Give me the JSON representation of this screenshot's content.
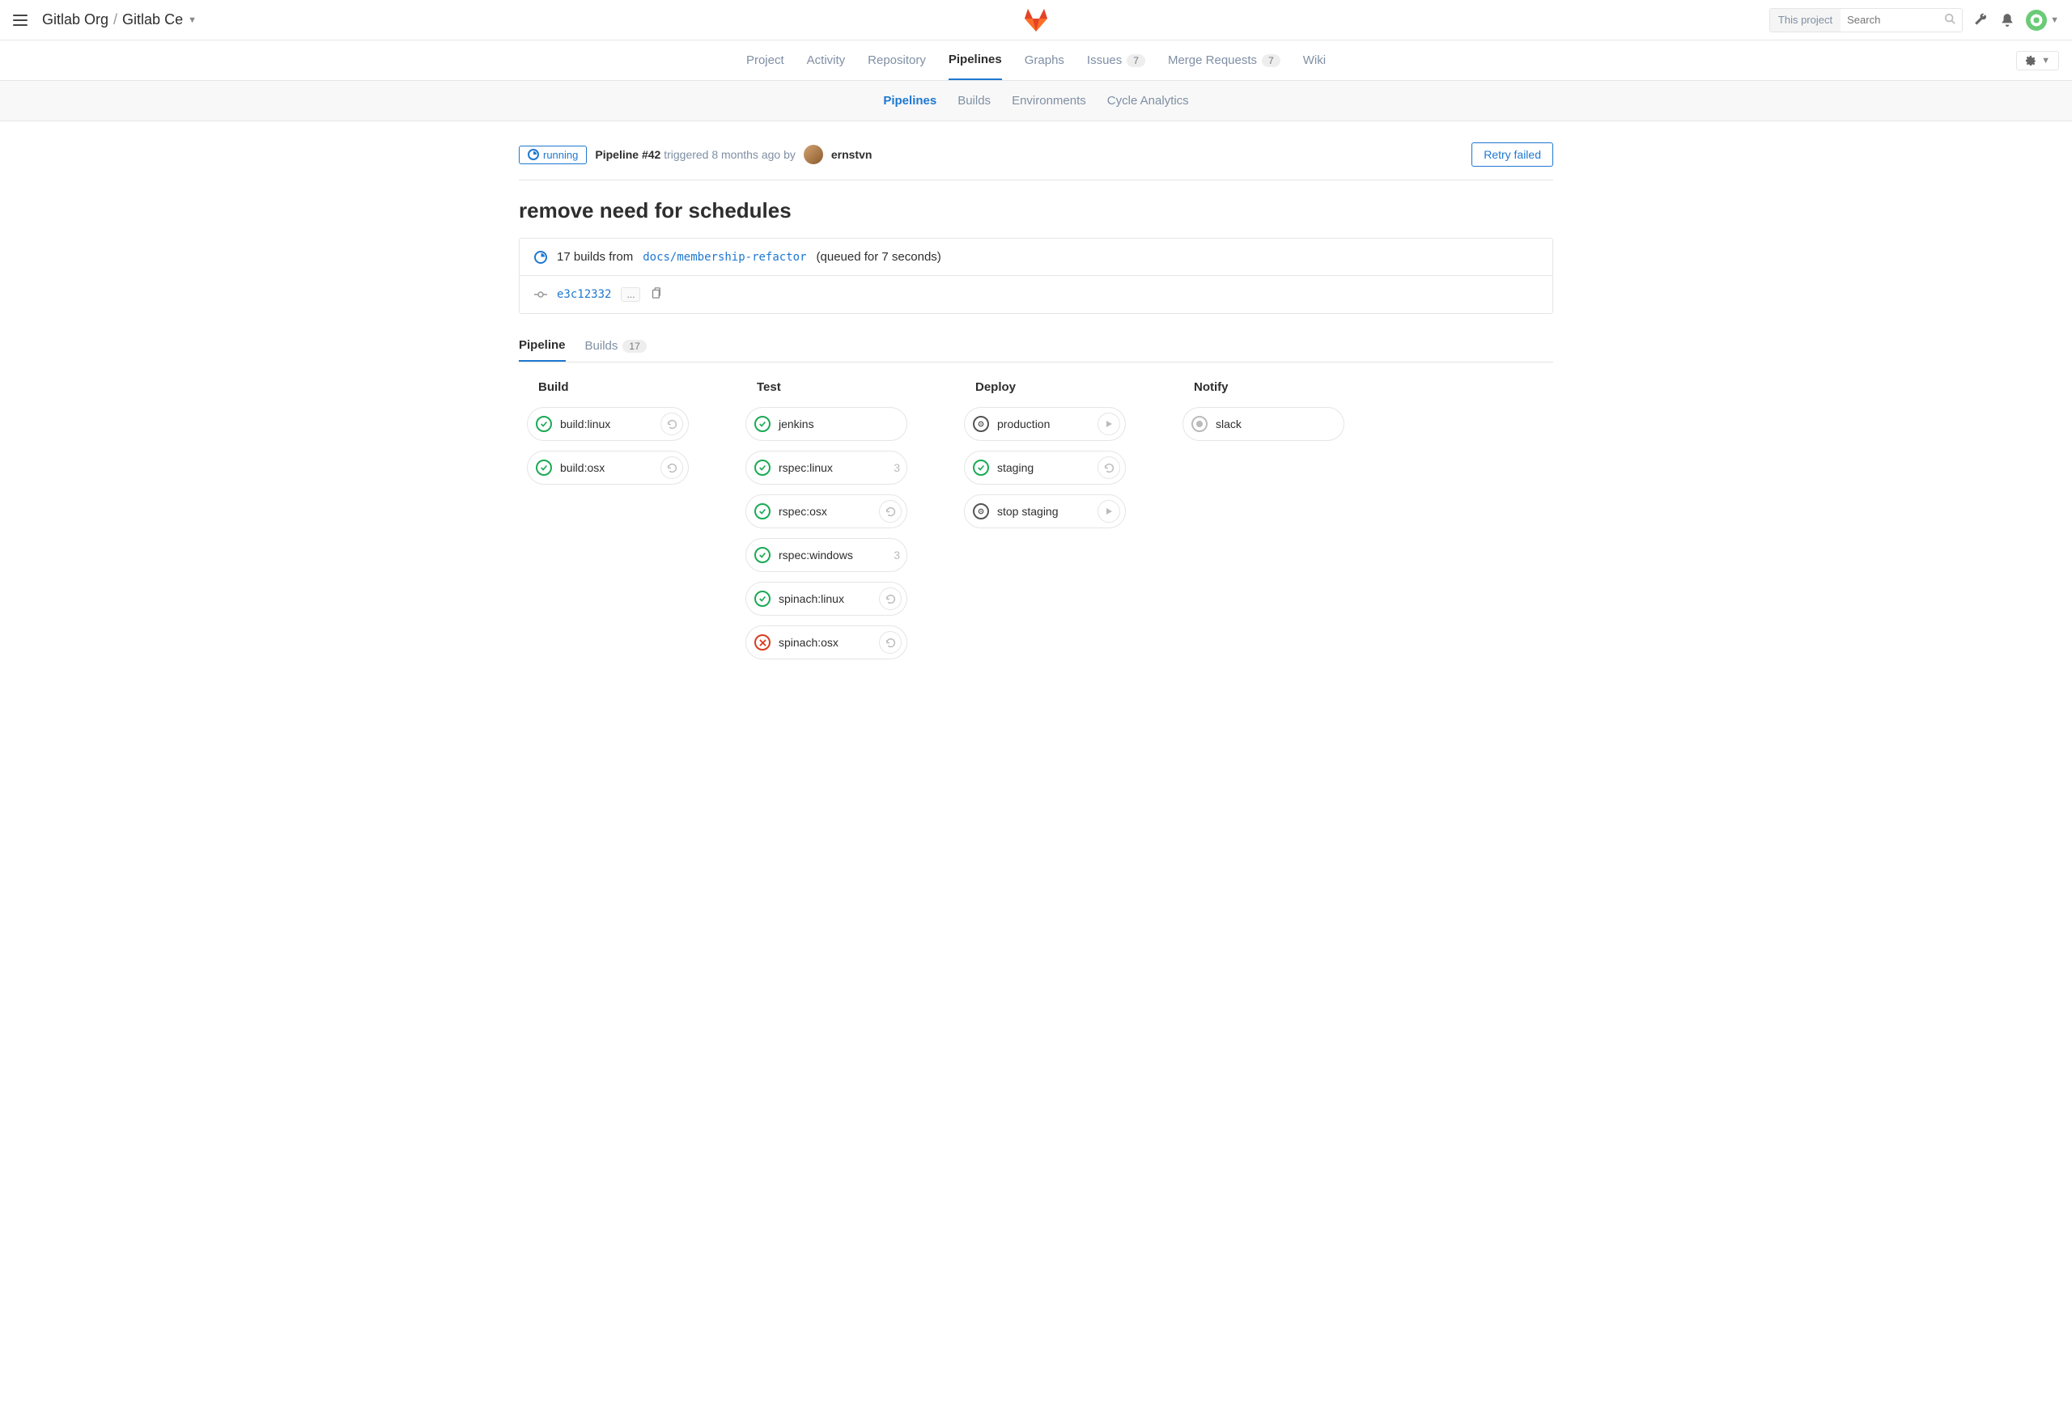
{
  "header": {
    "breadcrumb": {
      "org": "Gitlab Org",
      "project": "Gitlab Ce"
    },
    "search": {
      "scope": "This project",
      "placeholder": "Search"
    }
  },
  "nav": {
    "project": "Project",
    "activity": "Activity",
    "repository": "Repository",
    "pipelines": "Pipelines",
    "graphs": "Graphs",
    "issues": "Issues",
    "issues_count": "7",
    "merge_requests": "Merge Requests",
    "mr_count": "7",
    "wiki": "Wiki"
  },
  "subnav": {
    "pipelines": "Pipelines",
    "builds": "Builds",
    "environments": "Environments",
    "cycle": "Cycle Analytics"
  },
  "pipeline": {
    "status": "running",
    "meta_prefix": "Pipeline",
    "id": "#42",
    "meta_triggered": "triggered 8 months ago by",
    "author": "ernstvn",
    "retry": "Retry failed",
    "title": "remove need for schedules",
    "builds_text": "17 builds from",
    "branch": "docs/membership-refactor",
    "queued": "(queued for 7 seconds)",
    "commit": "e3c12332",
    "ellipsis": "..."
  },
  "tabs": {
    "pipeline": "Pipeline",
    "builds": "Builds",
    "builds_count": "17"
  },
  "stages": {
    "build": {
      "title": "Build",
      "jobs": [
        {
          "name": "build:linux",
          "status": "success",
          "action": "retry"
        },
        {
          "name": "build:osx",
          "status": "success",
          "action": "retry"
        }
      ]
    },
    "test": {
      "title": "Test",
      "jobs": [
        {
          "name": "jenkins",
          "status": "success"
        },
        {
          "name": "rspec:linux",
          "status": "success",
          "count": "3"
        },
        {
          "name": "rspec:osx",
          "status": "success",
          "action": "retry"
        },
        {
          "name": "rspec:windows",
          "status": "success",
          "count": "3"
        },
        {
          "name": "spinach:linux",
          "status": "success",
          "action": "retry"
        },
        {
          "name": "spinach:osx",
          "status": "failed",
          "action": "retry"
        }
      ]
    },
    "deploy": {
      "title": "Deploy",
      "jobs": [
        {
          "name": "production",
          "status": "manual",
          "action": "play"
        },
        {
          "name": "staging",
          "status": "success",
          "action": "retry"
        },
        {
          "name": "stop staging",
          "status": "manual",
          "action": "play"
        }
      ]
    },
    "notify": {
      "title": "Notify",
      "jobs": [
        {
          "name": "slack",
          "status": "created"
        }
      ]
    }
  }
}
